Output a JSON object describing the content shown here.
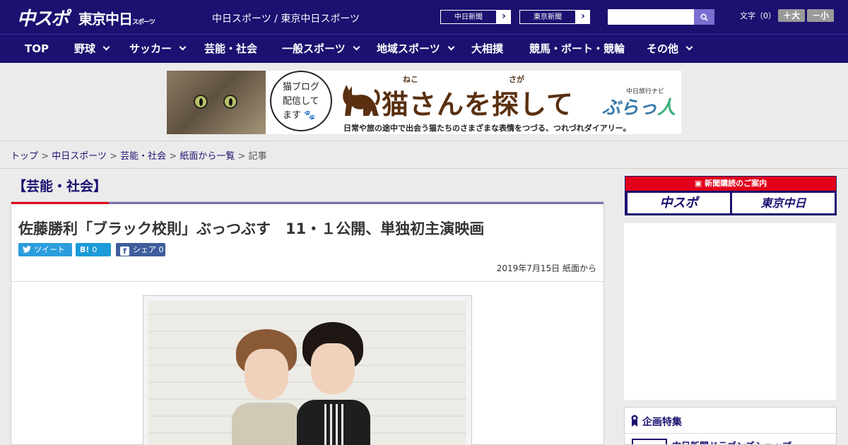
{
  "header": {
    "logo_chuspo": "中スポ",
    "logo_tokyo": "東京中日",
    "logo_tokyo_small": "スポーツ",
    "site_title": "中日スポーツ / 東京中日スポーツ",
    "paper_links": [
      "中日新聞",
      "東京新聞"
    ],
    "search_placeholder": "",
    "font_size_label": "文字（0）",
    "font_larger": "＋大",
    "font_smaller": "－小"
  },
  "nav": {
    "items": [
      {
        "label": "TOP",
        "has_dropdown": false
      },
      {
        "label": "野球",
        "has_dropdown": true
      },
      {
        "label": "サッカー",
        "has_dropdown": true
      },
      {
        "label": "芸能・社会",
        "has_dropdown": false
      },
      {
        "label": "一般スポーツ",
        "has_dropdown": true
      },
      {
        "label": "地域スポーツ",
        "has_dropdown": true
      },
      {
        "label": "大相撲",
        "has_dropdown": false
      },
      {
        "label": "競馬・ボート・競輪",
        "has_dropdown": false
      },
      {
        "label": "その他",
        "has_dropdown": true
      }
    ]
  },
  "banner": {
    "bubble_text": "猫ブログ配信してます",
    "ruby1": "ねこ",
    "ruby2": "さが",
    "title": "猫さんを探して",
    "brand_navi": "中日旅行ナビ",
    "brand_a": "ぶらっ",
    "brand_b": "人",
    "subtitle": "日常や旅の途中で出会う猫たちのさまざまな表情をつづる、つれづれダイアリー。"
  },
  "breadcrumb": {
    "items": [
      "トップ",
      "中日スポーツ",
      "芸能・社会",
      "紙面から一覧"
    ],
    "current": "記事",
    "separator": ">"
  },
  "article": {
    "category": "【芸能・社会】",
    "headline": "佐藤勝利「ブラック校則」ぶっつぶす　11・１公開、単独初主演映画",
    "share_tweet": "ツイート",
    "share_hatena_icon": "B!",
    "share_hatena_count": "0",
    "share_fb_label": "シェア",
    "share_fb_count": "0",
    "date": "2019年7月15日 紙面から"
  },
  "sidebar": {
    "subscription_head": "新聞購読のご案内",
    "subscription_logos": [
      "中スポ",
      "東京中日"
    ],
    "feature_head": "企画特集",
    "feature_item": "中日新聞ドラゴンズショップ"
  },
  "colors": {
    "brand_navy": "#1a1170",
    "accent_red": "#e2001a",
    "twitter": "#2b9ddc",
    "hatena": "#1a9ad8",
    "facebook": "#3f5d9c"
  }
}
